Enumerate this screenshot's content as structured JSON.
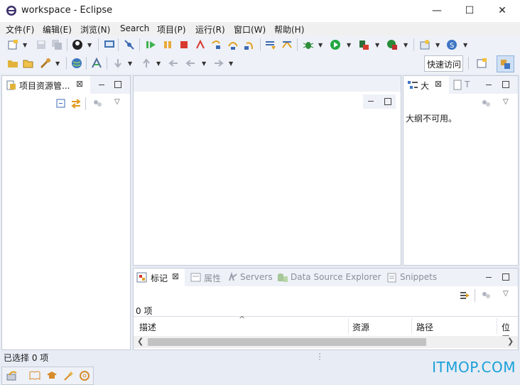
{
  "window": {
    "title": "workspace - Eclipse",
    "min_glyph": "—",
    "max_glyph": "☐",
    "close_glyph": "✕"
  },
  "menu": [
    "文件(F)",
    "编辑(E)",
    "浏览(N)",
    "Search",
    "项目(P)",
    "运行(R)",
    "窗口(W)",
    "帮助(H)"
  ],
  "toolbar": {
    "quick_access": "快速访问"
  },
  "explorer": {
    "tab_label": "项目资源管..."
  },
  "outline": {
    "tab_label": "大",
    "tab2_label": "T",
    "message": "大纲不可用。"
  },
  "bottom_tabs": {
    "markers": "标记",
    "properties": "属性",
    "servers": "Servers",
    "datasource": "Data Source Explorer",
    "snippets": "Snippets"
  },
  "markers": {
    "count": "0 项",
    "columns": [
      "描述",
      "资源",
      "路径",
      "位置"
    ],
    "sort_glyph": "^"
  },
  "status": {
    "selection": "已选择 0 项"
  },
  "watermark": "ITMOP.COM",
  "colors": {
    "accent": "#1aa0d8",
    "run_green": "#22a844",
    "stop_red": "#d83a2e"
  }
}
